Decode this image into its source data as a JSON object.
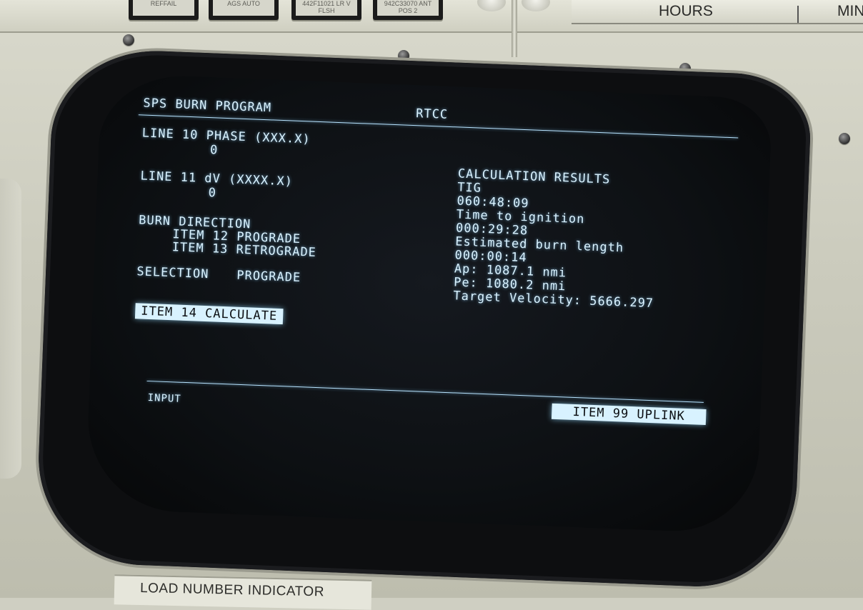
{
  "panel": {
    "lamps": [
      {
        "text": "REFFAIL"
      },
      {
        "text": "AGS AUTO"
      },
      {
        "text": "442F11021\nLR V FLSH"
      },
      {
        "text": "942C33070\nANT POS 2"
      }
    ],
    "hours_label": "HOURS",
    "min_label": "MIN",
    "bottom_label": "LOAD NUMBER INDICATOR"
  },
  "display": {
    "title": "SPS BURN PROGRAM",
    "system": "RTCC",
    "line10_label": "LINE 10 PHASE (XXX.X)",
    "line10_value": "0",
    "line11_label": "LINE 11 dV (XXXX.X)",
    "line11_value": "0",
    "burn_direction_label": "BURN DIRECTION",
    "item12": "ITEM 12 PROGRADE",
    "item13": "ITEM 13 RETROGRADE",
    "selection_label": "SELECTION",
    "selection_value": "PROGRADE",
    "item14": "ITEM 14 CALCULATE",
    "results_header": "CALCULATION RESULTS",
    "tig_label": "TIG",
    "tig_value": "060:48:09",
    "time_to_ignition_label": "Time to ignition",
    "time_to_ignition_value": "000:29:28",
    "burn_length_label": "Estimated burn length",
    "burn_length_value": "000:00:14",
    "ap": "Ap: 1087.1 nmi",
    "pe": "Pe: 1080.2 nmi",
    "target_velocity": "Target Velocity: 5666.297",
    "input_label": "INPUT",
    "item99": "ITEM 99 UPLINK"
  },
  "colors": {
    "phosphor": "#d9f2ff",
    "screen": "#0d1013",
    "panel": "#cfcfc2"
  }
}
